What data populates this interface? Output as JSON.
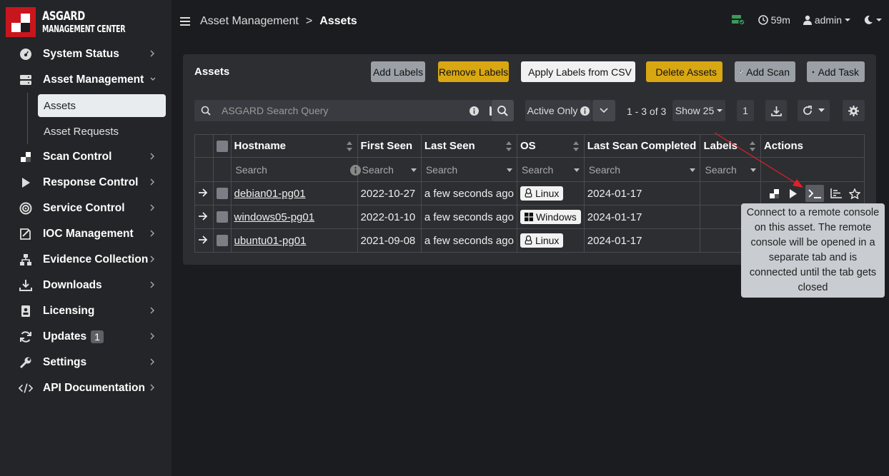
{
  "brand": {
    "title": "ASGARD",
    "subtitle": "MANAGEMENT CENTER"
  },
  "sidebar": {
    "items": [
      {
        "label": "System Status",
        "icon": "gauge-icon"
      },
      {
        "label": "Asset Management",
        "icon": "server-icon"
      },
      {
        "label": "Scan Control",
        "icon": "scan-icon"
      },
      {
        "label": "Response Control",
        "icon": "play-icon"
      },
      {
        "label": "Service Control",
        "icon": "target-icon"
      },
      {
        "label": "IOC Management",
        "icon": "ioc-icon"
      },
      {
        "label": "Evidence Collection",
        "icon": "sitemap-icon"
      },
      {
        "label": "Downloads",
        "icon": "download-icon"
      },
      {
        "label": "Licensing",
        "icon": "id-card-icon"
      },
      {
        "label": "Updates",
        "icon": "sync-icon",
        "badge": "1"
      },
      {
        "label": "Settings",
        "icon": "wrench-icon"
      },
      {
        "label": "API Documentation",
        "icon": "code-icon"
      }
    ],
    "subitems": [
      {
        "label": "Assets"
      },
      {
        "label": "Asset Requests"
      }
    ]
  },
  "topbar": {
    "breadcrumb_parent": "Asset Management",
    "breadcrumb_sep": ">",
    "breadcrumb_current": "Assets",
    "timer": "59m",
    "user": "admin"
  },
  "card": {
    "title": "Assets",
    "buttons": {
      "add_labels": "Add Labels",
      "remove_labels": "Remove Labels",
      "apply_csv": "Apply Labels from CSV",
      "delete_assets": "Delete Assets",
      "add_scan": "Add Scan",
      "add_task": "Add Task"
    },
    "search_placeholder": "ASGARD Search Query",
    "active_only": "Active Only",
    "pager": "1 - 3 of 3",
    "show": "Show 25",
    "page": "1"
  },
  "table": {
    "headers": [
      "Hostname",
      "First Seen",
      "Last Seen",
      "OS",
      "Last Scan Completed",
      "Labels",
      "Actions"
    ],
    "filter_placeholder": "Search",
    "rows": [
      {
        "hostname": "debian01-pg01",
        "first_seen": "2022-10-27",
        "last_seen": "a few seconds ago",
        "os": "Linux",
        "os_icon": "linux-icon",
        "last_scan": "2024-01-17",
        "labels": ""
      },
      {
        "hostname": "windows05-pg01",
        "first_seen": "2022-01-10",
        "last_seen": "a few seconds ago",
        "os": "Windows",
        "os_icon": "windows-icon",
        "last_scan": "2024-01-17",
        "labels": ""
      },
      {
        "hostname": "ubuntu01-pg01",
        "first_seen": "2021-09-08",
        "last_seen": "a few seconds ago",
        "os": "Linux",
        "os_icon": "linux-icon",
        "last_scan": "2024-01-17",
        "labels": ""
      }
    ]
  },
  "tooltip": {
    "text": "Connect to a remote console on this asset. The remote console will be opened in a separate tab and is connected until the tab gets closed"
  },
  "colors": {
    "accent_yellow": "#d9a712",
    "brand_red": "#c8161d",
    "status_green": "#3a9a5a",
    "annotation_red": "#e0202a"
  }
}
